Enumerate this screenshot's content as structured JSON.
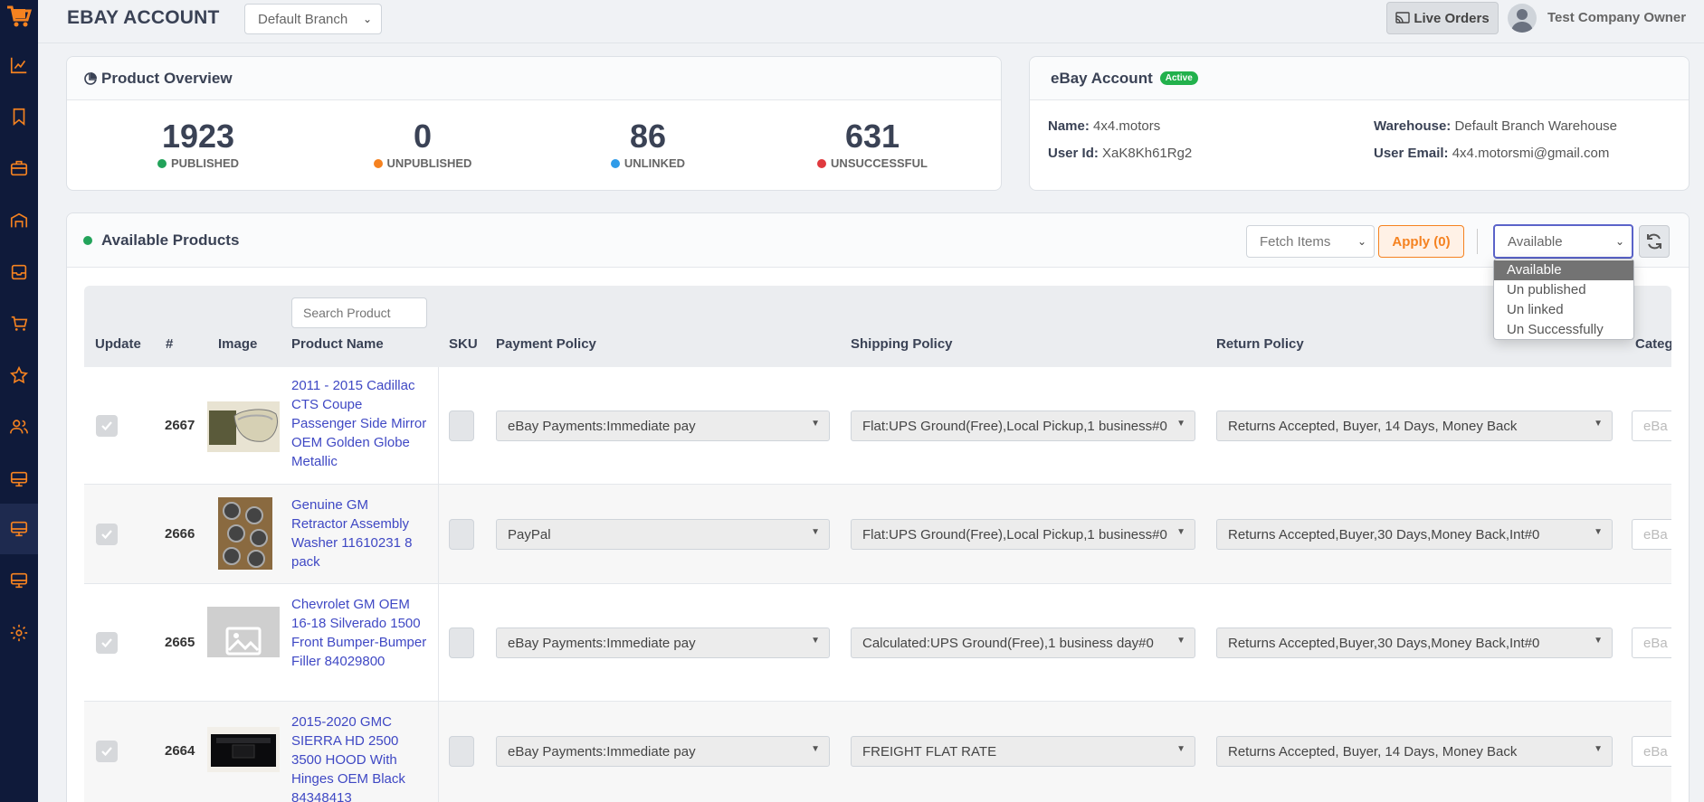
{
  "header": {
    "title": "EBAY ACCOUNT",
    "branch_select": "Default Branch",
    "live_orders": "Live Orders",
    "user_name": "Test Company Owner"
  },
  "sidebar": {
    "icons": [
      "chart-line-icon",
      "bookmark-icon",
      "briefcase-icon",
      "warehouse-icon",
      "inbox-icon",
      "cart-icon",
      "star-icon",
      "users-icon",
      "monitor-icon",
      "monitor-icon",
      "monitor-icon",
      "gear-icon"
    ],
    "active_index": 9
  },
  "overview": {
    "title": "Product Overview",
    "stats": [
      {
        "value": "1923",
        "label": "PUBLISHED",
        "color": "#22a35a"
      },
      {
        "value": "0",
        "label": "UNPUBLISHED",
        "color": "#f58220"
      },
      {
        "value": "86",
        "label": "UNLINKED",
        "color": "#2f9be8"
      },
      {
        "value": "631",
        "label": "UNSUCCESSFUL",
        "color": "#e0393e"
      }
    ]
  },
  "account": {
    "title": "eBay Account",
    "status_badge": "Active",
    "name_label": "Name:",
    "name": "4x4.motors",
    "user_id_label": "User Id:",
    "user_id": "XaK8Kh61Rg2",
    "warehouse_label": "Warehouse:",
    "warehouse": "Default Branch Warehouse",
    "email_label": "User Email:",
    "email": "4x4.motorsmi@gmail.com"
  },
  "products": {
    "title": "Available Products",
    "fetch_select": "Fetch Items",
    "apply_button": "Apply (0)",
    "status_select": "Available",
    "status_options": [
      "Available",
      "Un published",
      "Un linked",
      "Un Successfully"
    ],
    "search_placeholder": "Search Product",
    "columns": [
      "Update",
      "#",
      "Image",
      "Product Name",
      "SKU",
      "Payment Policy",
      "Shipping Policy",
      "Return Policy",
      "Categ"
    ],
    "rows": [
      {
        "id": "2667",
        "name": "2011 - 2015 Cadillac CTS Coupe Passenger Side Mirror OEM Golden Globe Metallic",
        "payment": "eBay Payments:Immediate pay",
        "shipping": "Flat:UPS Ground(Free),Local Pickup,1 business#0",
        "return": "Returns Accepted, Buyer, 14 Days, Money Back",
        "category": "eBa"
      },
      {
        "id": "2666",
        "name": "Genuine GM Retractor Assembly Washer 11610231 8 pack",
        "payment": "PayPal",
        "shipping": "Flat:UPS Ground(Free),Local Pickup,1 business#0",
        "return": "Returns Accepted,Buyer,30 Days,Money Back,Int#0",
        "category": "eBa"
      },
      {
        "id": "2665",
        "name": "Chevrolet GM OEM 16-18 Silverado 1500 Front Bumper-Bumper Filler 84029800",
        "payment": "eBay Payments:Immediate pay",
        "shipping": "Calculated:UPS Ground(Free),1 business day#0",
        "return": "Returns Accepted,Buyer,30 Days,Money Back,Int#0",
        "category": "eBa"
      },
      {
        "id": "2664",
        "name": "2015-2020 GMC SIERRA HD 2500 3500 HOOD With Hinges OEM Black 84348413",
        "payment": "eBay Payments:Immediate pay",
        "shipping": "FREIGHT FLAT RATE",
        "return": "Returns Accepted, Buyer, 14 Days, Money Back",
        "category": "eBa"
      }
    ]
  }
}
